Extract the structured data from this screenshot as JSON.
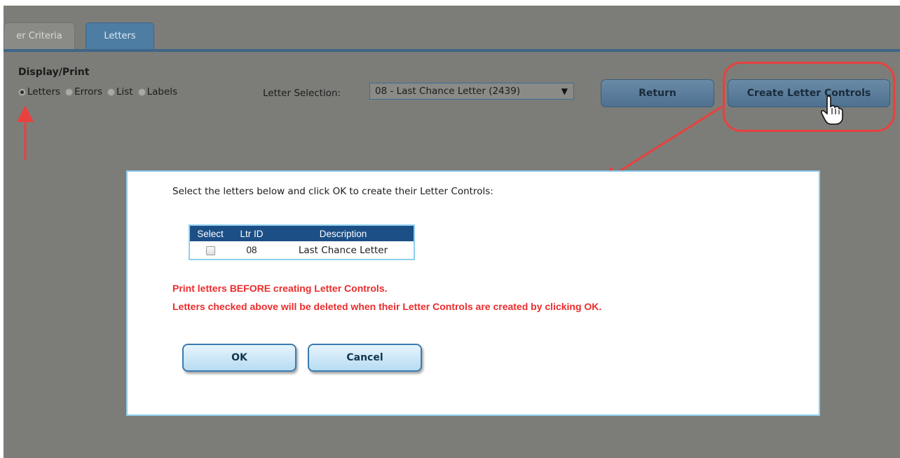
{
  "tabs": [
    {
      "label": "er Criteria"
    },
    {
      "label": "Letters"
    }
  ],
  "display_print": {
    "title": "Display/Print",
    "options": [
      {
        "label": "Letters",
        "checked": true
      },
      {
        "label": "Errors",
        "checked": false
      },
      {
        "label": "List",
        "checked": false
      },
      {
        "label": "Labels",
        "checked": false
      }
    ]
  },
  "letter_selection": {
    "label": "Letter Selection:",
    "selected": "08 - Last Chance Letter (2439)",
    "arrow": "▼"
  },
  "buttons": {
    "return_label": "Return",
    "create_controls_label": "Create Letter Controls"
  },
  "dialog": {
    "instructions": "Select the letters below and click OK to create their Letter Controls:",
    "table": {
      "headers": [
        "Select",
        "Ltr ID",
        "Description"
      ],
      "rows": [
        {
          "ltr_id": "08",
          "description": "Last Chance Letter",
          "checked": false
        }
      ]
    },
    "warnings": [
      "Print letters BEFORE creating Letter Controls.",
      "Letters checked above will be deleted when their Letter Controls are created by clicking OK."
    ],
    "ok_label": "OK",
    "cancel_label": "Cancel"
  },
  "colors": {
    "annotation_red": "#e8413f",
    "warning_red": "#ec2b2b",
    "table_header": "#1b4f86",
    "dialog_border": "#8fcfee"
  },
  "icons": [
    "hand-pointer-cursor-icon",
    "radio-icon",
    "dropdown-arrow-icon",
    "checkbox-icon"
  ]
}
